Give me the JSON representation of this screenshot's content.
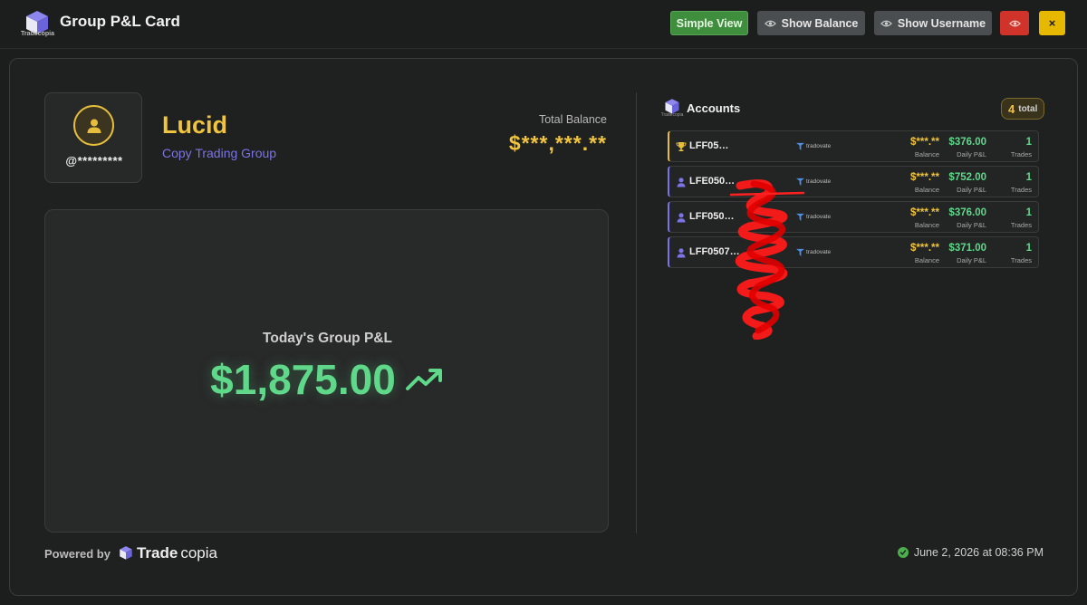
{
  "header": {
    "brand_small": "Tradecopia",
    "title": "Group P&L Card",
    "buttons": {
      "simple_view": "Simple View",
      "show_balance": "Show Balance",
      "show_username": "Show Username",
      "close": "×"
    }
  },
  "profile": {
    "handle": "@*********",
    "group_name": "Lucid",
    "group_type": "Copy Trading Group",
    "total_balance_label": "Total Balance",
    "total_balance_value": "$***,***.**"
  },
  "pnl": {
    "label": "Today's Group P&L",
    "value": "$1,875.00"
  },
  "accounts": {
    "title": "Accounts",
    "count": "4",
    "count_label": "total",
    "header_brand": "Tradecopia",
    "columns": {
      "balance": "Balance",
      "daily_pnl": "Daily P&L",
      "trades": "Trades"
    },
    "items": [
      {
        "name": "LFF05…",
        "broker": "tradovate",
        "balance": "$***.**",
        "daily_pnl": "$376.00",
        "trades": "1",
        "role": "top"
      },
      {
        "name": "LFE050…",
        "broker": "tradovate",
        "balance": "$***.**",
        "daily_pnl": "$752.00",
        "trades": "1",
        "role": "member"
      },
      {
        "name": "LFF050…",
        "broker": "tradovate",
        "balance": "$***.**",
        "daily_pnl": "$376.00",
        "trades": "1",
        "role": "member"
      },
      {
        "name": "LFF0507…",
        "broker": "tradovate",
        "balance": "$***.**",
        "daily_pnl": "$371.00",
        "trades": "1",
        "role": "member"
      }
    ]
  },
  "footer": {
    "powered_by": "Powered by",
    "brand_bold": "Trade",
    "brand_light": "copia",
    "timestamp": "June 2, 2026 at 08:36 PM"
  },
  "colors": {
    "gold": "#f0c43f",
    "green": "#5fd88a",
    "purple": "#7b74e6",
    "red": "#d0332a",
    "yellow_button": "#e6b800"
  }
}
